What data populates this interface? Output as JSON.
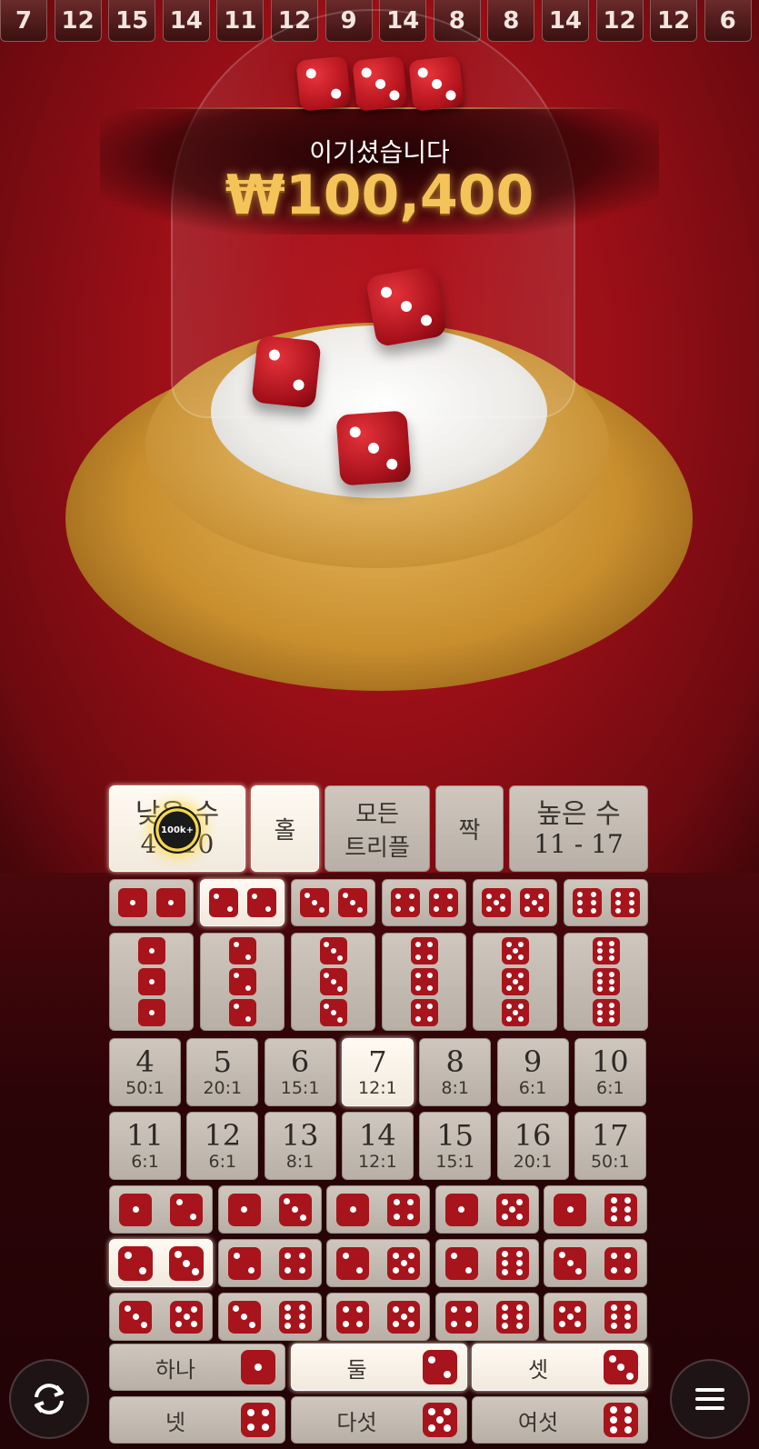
{
  "history": [
    "7",
    "12",
    "15",
    "14",
    "11",
    "12",
    "9",
    "14",
    "8",
    "8",
    "14",
    "12",
    "12",
    "6"
  ],
  "result": {
    "dice": [
      2,
      3,
      3
    ],
    "label": "이기셨습니다",
    "amount": "₩100,400"
  },
  "bets": {
    "low": {
      "label": "낮은 수",
      "range": "4 - 10"
    },
    "odd": {
      "label": "홀"
    },
    "any_triple": {
      "label_line1": "모든",
      "label_line2": "트리플"
    },
    "even": {
      "label": "짝"
    },
    "high": {
      "label": "높은 수",
      "range": "11 - 17"
    },
    "chip_label": "100k+",
    "totals_row1": [
      {
        "num": "4",
        "odds": "50:1"
      },
      {
        "num": "5",
        "odds": "20:1"
      },
      {
        "num": "6",
        "odds": "15:1"
      },
      {
        "num": "7",
        "odds": "12:1"
      },
      {
        "num": "8",
        "odds": "8:1"
      },
      {
        "num": "9",
        "odds": "6:1"
      },
      {
        "num": "10",
        "odds": "6:1"
      }
    ],
    "totals_row2": [
      {
        "num": "11",
        "odds": "6:1"
      },
      {
        "num": "12",
        "odds": "6:1"
      },
      {
        "num": "13",
        "odds": "8:1"
      },
      {
        "num": "14",
        "odds": "12:1"
      },
      {
        "num": "15",
        "odds": "15:1"
      },
      {
        "num": "16",
        "odds": "20:1"
      },
      {
        "num": "17",
        "odds": "50:1"
      }
    ],
    "singles": [
      {
        "label": "하나",
        "face": 1
      },
      {
        "label": "둘",
        "face": 2
      },
      {
        "label": "셋",
        "face": 3
      },
      {
        "label": "넷",
        "face": 4
      },
      {
        "label": "다섯",
        "face": 5
      },
      {
        "label": "여섯",
        "face": 6
      }
    ]
  },
  "controls": {
    "repeat_icon": "repeat-icon",
    "menu_icon": "hamburger-menu-icon"
  },
  "colors": {
    "felt": "#9a0f17",
    "die": "#a8141c",
    "gold": "#f4c45a",
    "cell": "#c4bcb2",
    "cell_lit": "#fffaf2"
  }
}
